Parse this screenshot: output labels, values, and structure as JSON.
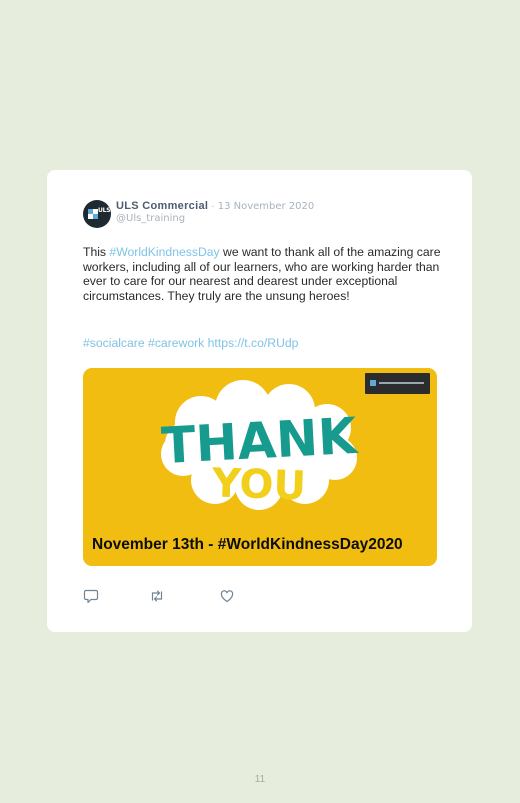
{
  "tweet": {
    "display_name": "ULS Commercial",
    "separator": "·",
    "date": "13 November 2020",
    "handle": "@Uls_training",
    "avatar_text": "ULS",
    "text_intro": "This ",
    "hashtag_1": "#WorldKindnessDay",
    "text_rest": " we want to thank all of the amazing care workers, including all of our learners, who are working harder than ever to care for our nearest and dearest under exceptional circumstances. They truly are the unsung heroes!",
    "hashtag_2": "#socialcare",
    "hashtag_3": "#carework",
    "link": "https://t.co/RUdp",
    "media": {
      "image_text_line1": "THANK",
      "image_text_line2": "YOU",
      "caption": "November 13th - #WorldKindnessDay2020",
      "background_color": "#f0bd10"
    },
    "actions": [
      "reply-icon",
      "retweet-icon",
      "like-icon"
    ]
  },
  "page_number": "11"
}
